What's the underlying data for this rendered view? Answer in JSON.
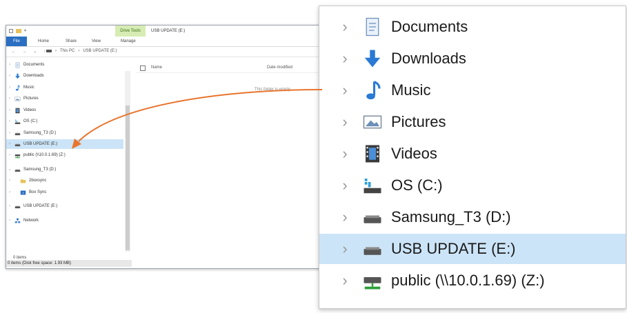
{
  "window": {
    "title": "USB UPDATE (E:)",
    "drive_tools_label": "Drive Tools",
    "ribbon": {
      "tabs": [
        "File",
        "Home",
        "Share",
        "View",
        "Manage"
      ]
    },
    "breadcrumb": [
      "This PC",
      "USB UPDATE (E:)"
    ],
    "sidebar": [
      {
        "label": "Documents",
        "icon": "documents-icon"
      },
      {
        "label": "Downloads",
        "icon": "downloads-icon"
      },
      {
        "label": "Music",
        "icon": "music-icon"
      },
      {
        "label": "Pictures",
        "icon": "pictures-icon"
      },
      {
        "label": "Videos",
        "icon": "videos-icon"
      },
      {
        "label": "OS (C:)",
        "icon": "os-drive-icon"
      },
      {
        "label": "Samsung_T3 (D:)",
        "icon": "drive-icon"
      },
      {
        "label": "USB UPDATE (E:)",
        "icon": "drive-icon",
        "selected": true
      },
      {
        "label": "public (\\\\10.0.1.69) (Z:)",
        "icon": "network-drive-icon"
      },
      {
        "label": "Samsung_T3 (D:)",
        "icon": "drive-icon"
      },
      {
        "label": "2boxsync",
        "icon": "folder-icon"
      },
      {
        "label": "Box Sync",
        "icon": "box-sync-icon"
      },
      {
        "label": "USB UPDATE (E:)",
        "icon": "drive-icon"
      },
      {
        "label": "Network",
        "icon": "network-icon"
      }
    ],
    "columns": {
      "name": "Name",
      "date": "Date modified"
    },
    "empty_message": "This folder is empty.",
    "status_items": "0 items",
    "status_bottom": "0 items (Disk free space: 1.93 MB)"
  },
  "zoomed": {
    "items": [
      {
        "label": "Documents",
        "icon": "documents-icon"
      },
      {
        "label": "Downloads",
        "icon": "downloads-icon"
      },
      {
        "label": "Music",
        "icon": "music-icon"
      },
      {
        "label": "Pictures",
        "icon": "pictures-icon"
      },
      {
        "label": "Videos",
        "icon": "videos-icon"
      },
      {
        "label": "OS (C:)",
        "icon": "os-drive-icon"
      },
      {
        "label": "Samsung_T3 (D:)",
        "icon": "drive-icon"
      },
      {
        "label": "USB UPDATE (E:)",
        "icon": "drive-icon",
        "selected": true
      },
      {
        "label": "public (\\\\10.0.1.69) (Z:)",
        "icon": "network-drive-icon"
      }
    ]
  },
  "colors": {
    "arrow": "#e8742d",
    "selection": "#cce4f7",
    "file_tab": "#2b6fc2",
    "drive_tools": "#d6ecb2"
  }
}
